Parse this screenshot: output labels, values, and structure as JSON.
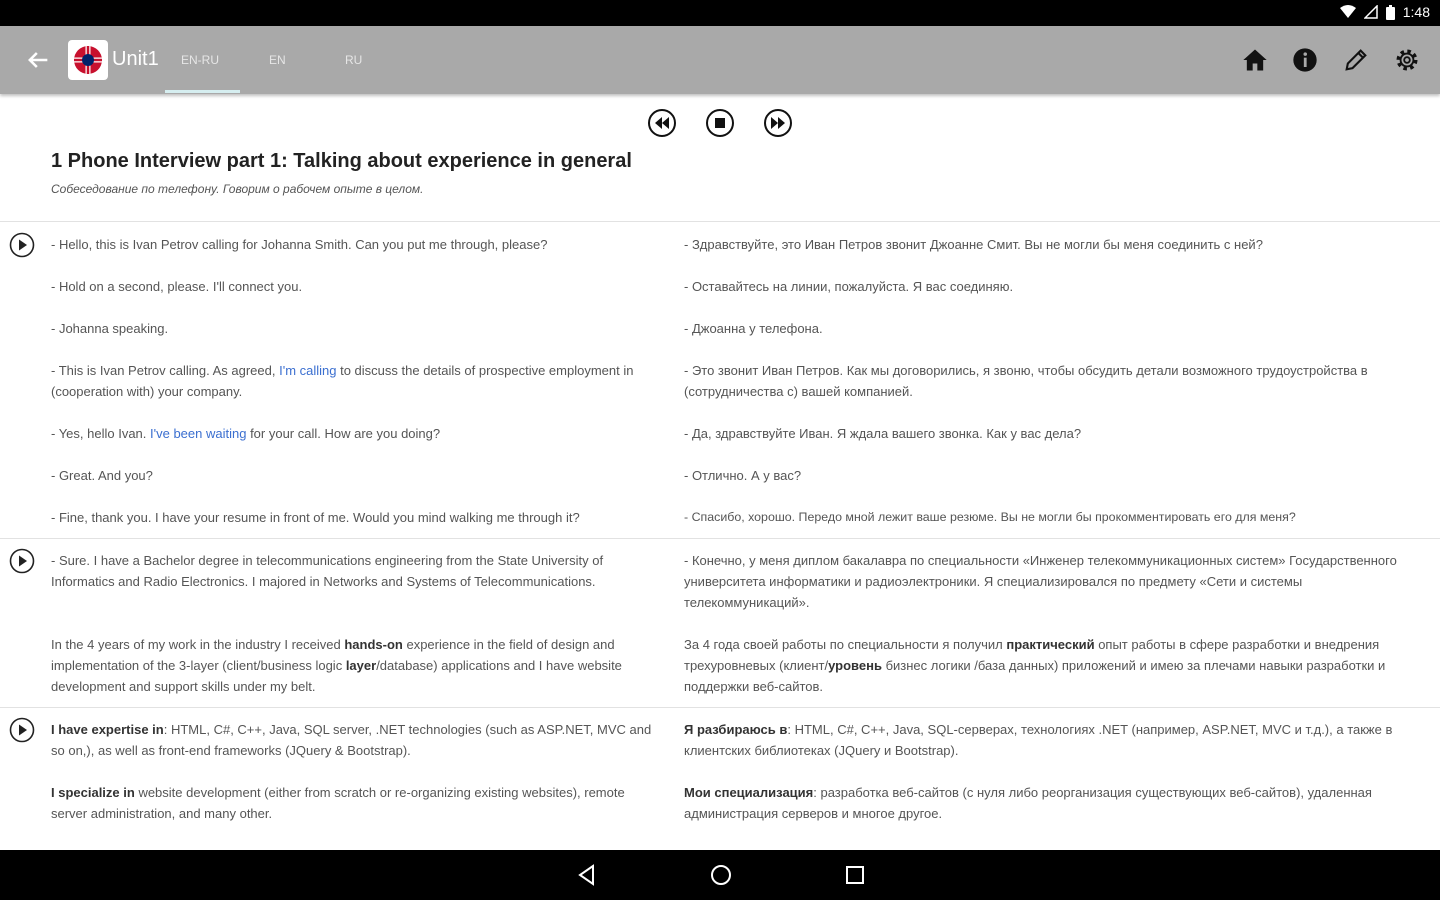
{
  "status": {
    "time": "1:48",
    "wifi_icon": "wifi-icon",
    "signal_icon": "signal-icon",
    "battery_icon": "battery-icon"
  },
  "appbar": {
    "title": "Unit1",
    "tabs": [
      "EN-RU",
      "EN",
      "RU"
    ],
    "active_tab": "EN-RU",
    "icons": [
      "home-icon",
      "info-icon",
      "pencil-icon",
      "gear-icon"
    ],
    "background": "#a9a9a9"
  },
  "player": {
    "icons": [
      "rewind-icon",
      "stop-icon",
      "fast-forward-icon"
    ]
  },
  "lesson": {
    "title": "1 Phone Interview part 1: Talking about experience in general",
    "subtitle": "Собеседование по телефону. Говорим о рабочем опыте в целом."
  },
  "blocks": [
    {
      "lines": [
        {
          "en": [
            "- Hello, this is Ivan Petrov calling for Johanna Smith. Can you put me through, please?"
          ],
          "ru": [
            "- Здравствуйте, это Иван Петров звонит Джоанне Смит. Вы не могли бы меня соединить с ней?"
          ]
        },
        {
          "en": [
            "- Hold on a second, please. I'll connect you."
          ],
          "ru": [
            "- Оставайтесь на линии, пожалуйста. Я вас соединяю."
          ]
        },
        {
          "en": [
            "- Johanna speaking."
          ],
          "ru": [
            "- Джоанна у телефона."
          ]
        },
        {
          "en": [
            "- This is Ivan Petrov calling. As agreed, ",
            "I'm calling",
            " to discuss the details of prospective employment in (cooperation with) your company."
          ],
          "ru": [
            "- Это звонит Иван Петров. Как мы договорились, я звоню, чтобы обсудить детали возможного трудоустройства в (сотрудничества с) вашей компанией."
          ]
        },
        {
          "en": [
            "- Yes, hello Ivan. ",
            "I've been waiting",
            " for your call. How are you doing?"
          ],
          "ru": [
            "- Да, здравствуйте Иван. Я ждала вашего звонка. Как у вас дела?"
          ]
        },
        {
          "en": [
            "- Great. And you?"
          ],
          "ru": [
            "- Отлично. А у вас?"
          ]
        },
        {
          "en": [
            "- Fine, thank you. I have your resume in front of me. Would you mind walking me through it?"
          ],
          "ru": [
            "- Спасибо, хорошо. Передо мной лежит ваше резюме. Вы не могли бы прокомментировать его для меня?"
          ]
        }
      ]
    },
    {
      "lines": [
        {
          "en": [
            "- Sure. I have a Bachelor degree in telecommunications engineering from the State University of Informatics and Radio Electronics. I majored in Networks and Systems of Telecommunications."
          ],
          "ru": [
            "- Конечно, у меня диплом бакалавра по специальности «Инженер телекоммуникационных систем» Государственного университета информатики и радиоэлектроники. Я специализировался по предмету «Сети и системы телекоммуникаций»."
          ]
        },
        {
          "en": [
            "In the 4 years of my work in the industry I received ",
            "hands-on",
            " experience in the field of design and implementation of the 3-layer (client/business logic ",
            "layer",
            "/database) applications and I have website development and support skills under my belt."
          ],
          "ru": [
            "За 4 года своей работы по специальности я получил ",
            "практический",
            " опыт работы в сфере разработки и внедрения трехуровневых (клиент/",
            "уровень",
            " бизнес логики /база данных) приложений и имею за плечами навыки разработки и поддержки веб-сайтов."
          ]
        }
      ]
    },
    {
      "lines": [
        {
          "en": [
            "I have expertise in",
            ": HTML, C#, C++, Java, SQL server, .NET technologies (such as ASP.NET, MVC and so on,), as well as front-end frameworks (JQuery & Bootstrap)."
          ],
          "ru": [
            "Я разбираюсь в",
            ": HTML, C#, C++, Java, SQL-серверах, технологиях .NET (например, ASP.NET, MVC и т.д.), а также в клиентских библиотеках (JQuery и Bootstrap)."
          ]
        },
        {
          "en": [
            "I specialize in",
            " website development (either from scratch or re-organizing existing websites), remote server administration, and many other."
          ],
          "ru": [
            "Мои специализация",
            ": разработка веб-сайтов (с нуля либо реорганизация существующих веб-сайтов), удаленная администрация серверов и многое другое."
          ]
        }
      ]
    }
  ],
  "navbar": {
    "icons": [
      "back-triangle-icon",
      "home-circle-icon",
      "recents-square-icon"
    ]
  }
}
